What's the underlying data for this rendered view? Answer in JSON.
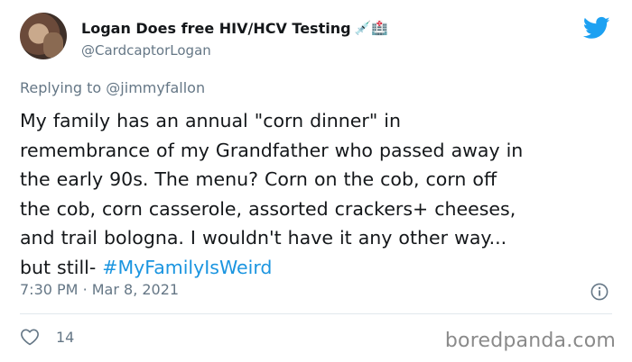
{
  "author": {
    "display_name": "Logan Does free HIV/HCV Testing",
    "emoji": "💉🏥",
    "handle": "@CardcaptorLogan"
  },
  "reply": {
    "prefix": "Replying to",
    "mention": "@jimmyfallon"
  },
  "tweet": {
    "lines": [
      "My family has an annual \"corn dinner\" in",
      "remembrance of my Grandfather who passed away in",
      "the early 90s. The menu? Corn on the cob, corn off",
      "the cob, corn casserole, assorted crackers+ cheeses,",
      "and trail bologna. I wouldn't have it any other way...",
      "but still-"
    ],
    "hashtag": "#MyFamilyIsWeird"
  },
  "meta": {
    "time": "7:30 PM",
    "separator": "·",
    "date": "Mar 8, 2021"
  },
  "engagement": {
    "likes": "14"
  },
  "watermark": "boredpanda.com",
  "colors": {
    "twitter_blue": "#1da1f2",
    "hashtag": "#1b95e0",
    "secondary_text": "#657786"
  },
  "icons": {
    "brand": "twitter-bird-icon",
    "info": "info-icon",
    "like": "heart-icon"
  }
}
